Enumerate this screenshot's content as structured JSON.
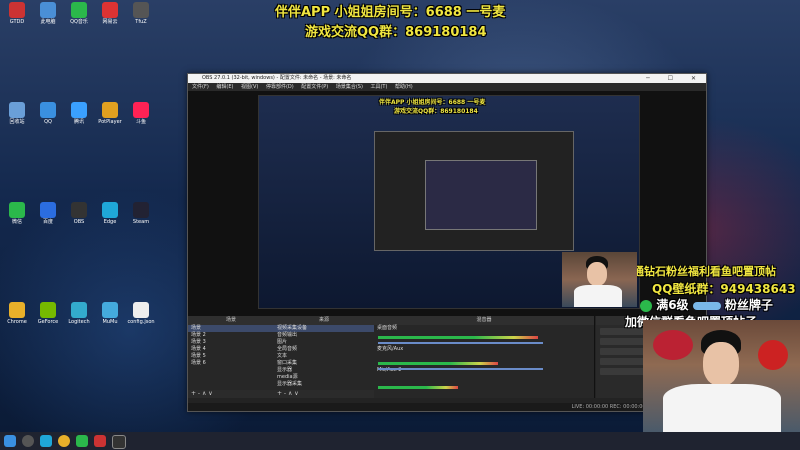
{
  "overlay": {
    "line1": "伴伴APP 小姐姐房间号：6688 一号麦",
    "line2": "游戏交流QQ群：869180184",
    "promo1": "开通钻石粉丝福利看鱼吧置顶帖",
    "promo2": "QQ壁纸群：949438643",
    "promo3": "满6级",
    "promo3b": "粉丝牌子",
    "promo4": "加微信群看鱼吧置顶帖子"
  },
  "desktop_icons": [
    {
      "label": "GTDD",
      "color": "#c33"
    },
    {
      "label": "此电脑",
      "color": "#4a8fd6"
    },
    {
      "label": "QQ音乐",
      "color": "#2bb84b"
    },
    {
      "label": "网易云",
      "color": "#d33"
    },
    {
      "label": "TfuZ",
      "color": "#555"
    },
    {
      "label": "回收站",
      "color": "#6a9fd8"
    },
    {
      "label": "QQ",
      "color": "#3a90e0"
    },
    {
      "label": "腾讯",
      "color": "#3aa0ff"
    },
    {
      "label": "PotPlayer",
      "color": "#e0a020"
    },
    {
      "label": "斗鱼",
      "color": "#f25"
    },
    {
      "label": "微信",
      "color": "#2bb84b"
    },
    {
      "label": "百度",
      "color": "#2b6de0"
    },
    {
      "label": "OBS",
      "color": "#333"
    },
    {
      "label": "Edge",
      "color": "#1fa7d8"
    },
    {
      "label": "Steam",
      "color": "#223"
    },
    {
      "label": "Chrome",
      "color": "#e8b02a"
    },
    {
      "label": "GeForce",
      "color": "#76b900"
    },
    {
      "label": "Logitech",
      "color": "#3ac"
    },
    {
      "label": "MuMu",
      "color": "#4ad"
    },
    {
      "label": "config.json",
      "color": "#eee"
    }
  ],
  "obs": {
    "title": "OBS 27.0.1 (32-bit, windows) - 配置文件: 未命名 - 场景: 未命名",
    "menu": [
      "文件(F)",
      "编辑(E)",
      "视图(V)",
      "停靠部件(D)",
      "配置文件(P)",
      "场景集合(S)",
      "工具(T)",
      "帮助(H)"
    ],
    "docks": {
      "scenes_title": "场景",
      "scenes": [
        "场景",
        "场景 2",
        "场景 3",
        "场景 4",
        "场景 5",
        "场景 6"
      ],
      "sources_title": "来源",
      "sources": [
        "视频采集设备",
        "音频输出",
        "图片",
        "全局音频",
        "文本",
        "窗口采集",
        "显示器",
        "media源",
        "显示器采集"
      ],
      "mixer_title": "混音器",
      "mixer": [
        "桌面音频",
        "麦克风/Aux",
        "Mic/Aux 2"
      ],
      "transitions_title": "场景过渡",
      "controls_title": "控件",
      "footer": "+ - ∧ ∨"
    },
    "status": "LIVE: 00:00:00   REC: 00:00:00   CPU: 8.7%, 30.00 fps"
  }
}
